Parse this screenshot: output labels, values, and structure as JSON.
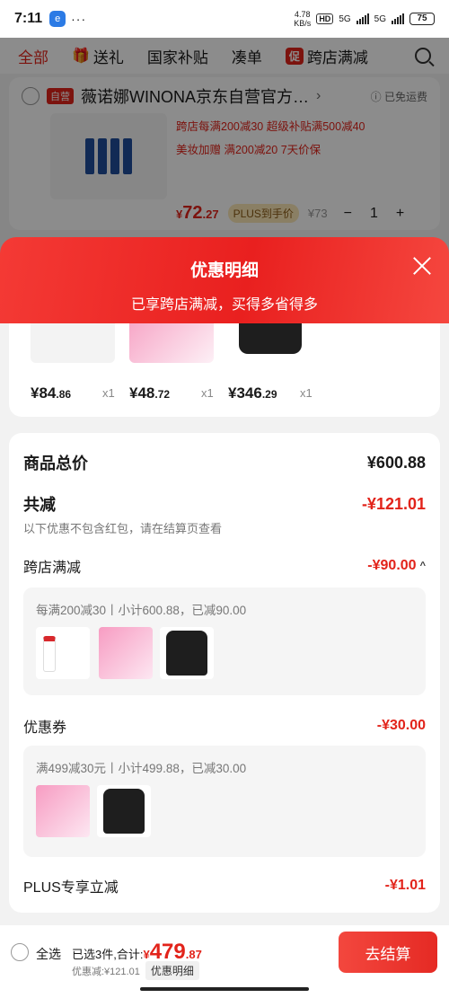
{
  "status": {
    "time": "7:11",
    "app_letter": "e",
    "dots": "···",
    "speed_top": "4.78",
    "speed_bottom": "KB/s",
    "hd": "HD",
    "net1": "5G",
    "net2": "5G",
    "battery": "75"
  },
  "tabs": [
    {
      "label": "全部"
    },
    {
      "label": "送礼"
    },
    {
      "label": "国家补贴"
    },
    {
      "label": "凑单"
    },
    {
      "label": "跨店满减",
      "badge": "促"
    }
  ],
  "store": {
    "badge": "自营",
    "name": "薇诺娜WINONA京东自营官方…",
    "chevron": "›",
    "shipping": "ⓘ 已免运费"
  },
  "product": {
    "promo_lines": [
      "跨店每满200减30  超级补贴满500减40",
      "美妆加赠  满200减20  7天价保"
    ],
    "price_symbol": "¥",
    "price_int": "72",
    "price_dec": ".27",
    "plus_chip": "PLUS到手价",
    "old_price": "¥73",
    "minus": "−",
    "qty": "1",
    "plus": "+"
  },
  "sheet": {
    "title": "优惠明细",
    "subtitle": "已享跨店满减，买得多省得多",
    "items": [
      {
        "price_int": "¥84",
        "price_dec": ".86",
        "qty": "x1"
      },
      {
        "price_int": "¥48",
        "price_dec": ".72",
        "qty": "x1"
      },
      {
        "price_int": "¥346",
        "price_dec": ".29",
        "qty": "x1"
      }
    ],
    "total_label": "商品总价",
    "total_value": "¥600.88",
    "cut_label": "共减",
    "cut_value": "-¥121.01",
    "cut_note": "以下优惠不包含红包，请在结算页查看",
    "cross_store": {
      "label": "跨店满减",
      "value": "-¥90.00",
      "caret": "^",
      "detail": "每满200减30丨小计600.88，已减90.00"
    },
    "coupon": {
      "label": "优惠券",
      "value": "-¥30.00",
      "detail": "满499减30元丨小计499.88，已减30.00"
    },
    "plus_label": "PLUS专享立减",
    "plus_value": "-¥1.01"
  },
  "bottom": {
    "select_all": "全选",
    "selected": "已选3件,合计:",
    "currency": "¥",
    "sum_int": "479",
    "sum_dec": ".87",
    "discount": "优惠减:¥121.01",
    "detail_chip": "优惠明细",
    "checkout": "去结算"
  },
  "colors": {
    "accent": "#e2231a",
    "sheet_header": "#ef2b27",
    "plus_chip": "#fbe7b7"
  }
}
